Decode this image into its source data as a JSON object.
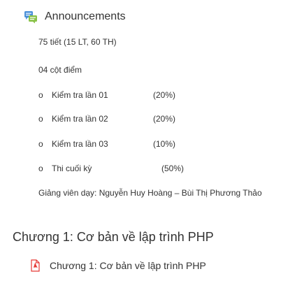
{
  "announcements": {
    "label": "Announcements",
    "icon": "forum-icon"
  },
  "summary": {
    "periods": "75 tiết (15 LT, 60 TH)",
    "grade_count": "04 cột điểm",
    "bullet": "o",
    "grade_items": [
      {
        "name": "Kiểm tra lần 01",
        "weight": "(20%)"
      },
      {
        "name": "Kiểm tra lần 02",
        "weight": "(20%)"
      },
      {
        "name": "Kiểm tra lần 03",
        "weight": "(10%)"
      },
      {
        "name": "Thi cuối kỳ",
        "weight": "(50%)"
      }
    ],
    "lecturers": "Giảng viên dạy: Nguyễn Huy Hoàng – Bùi Thị Phương Thảo"
  },
  "section": {
    "title": "Chương 1: Cơ bản về lập trình PHP",
    "resource": {
      "label": "Chương 1: Cơ bản về lập trình PHP",
      "icon": "pdf-icon"
    }
  },
  "colors": {
    "text": "#333333",
    "forum_icon_blue": "#4a90d9",
    "forum_icon_green": "#8bc34a",
    "pdf_red": "#e53935"
  }
}
